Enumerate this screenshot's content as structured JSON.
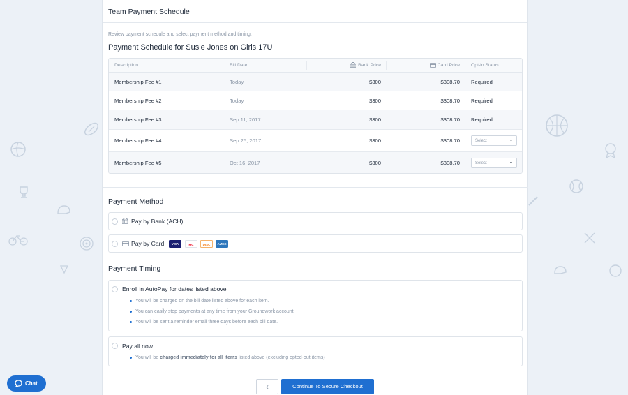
{
  "panel": {
    "title": "Team Payment Schedule",
    "intro": "Review payment schedule and select payment method and timing.",
    "schedule_title": "Payment Schedule for Susie Jones on Girls 17U"
  },
  "table": {
    "headers": {
      "description": "Description",
      "bill_date": "Bill Date",
      "bank_price": "Bank Price",
      "card_price": "Card Price",
      "opt_in": "Opt-in Status"
    },
    "rows": [
      {
        "description": "Membership Fee #1",
        "date": "Today",
        "bank": "$300",
        "card": "$308.70",
        "status": "Required"
      },
      {
        "description": "Membership Fee #2",
        "date": "Today",
        "bank": "$300",
        "card": "$308.70",
        "status": "Required"
      },
      {
        "description": "Membership Fee #3",
        "date": "Sep 11, 2017",
        "bank": "$300",
        "card": "$308.70",
        "status": "Required"
      },
      {
        "description": "Membership Fee #4",
        "date": "Sep 25, 2017",
        "bank": "$300",
        "card": "$308.70",
        "select": "Select"
      },
      {
        "description": "Membership Fee #5",
        "date": "Oct 16, 2017",
        "bank": "$300",
        "card": "$308.70",
        "select": "Select"
      }
    ]
  },
  "payment_method": {
    "title": "Payment Method",
    "bank_label": "Pay by Bank (ACH)",
    "card_label": "Pay by Card",
    "card_logos": [
      "VISA",
      "MC",
      "DISC",
      "AMEX"
    ]
  },
  "payment_timing": {
    "title": "Payment Timing",
    "autopay_label": "Enroll in AutoPay for dates listed above",
    "autopay_bullets": [
      "You will be charged on the bill date listed above for each item.",
      "You can easily stop payments at any time from your Groundwork account.",
      "You will be sent a reminder email three days before each bill date."
    ],
    "pay_now_label": "Pay all now",
    "pay_now_pre": "You will be ",
    "pay_now_bold": "charged immediately for all items",
    "pay_now_post": " listed above (excluding opted-out items)"
  },
  "footer": {
    "back_glyph": "‹",
    "checkout_label": "Continue To Secure Checkout"
  },
  "chat": {
    "label": "Chat"
  },
  "colors": {
    "accent": "#1f6fd1",
    "background": "#ecf1f7",
    "visa": "#1a1f71",
    "mastercard": "#eb001b",
    "discover": "#f58220",
    "amex": "#2e77bc"
  }
}
